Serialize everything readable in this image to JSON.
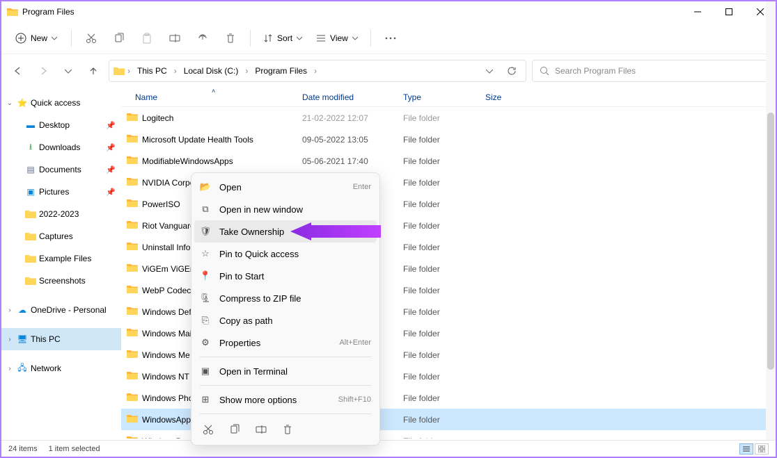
{
  "window": {
    "title": "Program Files"
  },
  "toolbar": {
    "new_label": "New",
    "sort_label": "Sort",
    "view_label": "View"
  },
  "breadcrumb": [
    "This PC",
    "Local Disk (C:)",
    "Program Files"
  ],
  "search": {
    "placeholder": "Search Program Files"
  },
  "sidebar": {
    "quick_access": "Quick access",
    "desktop": "Desktop",
    "downloads": "Downloads",
    "documents": "Documents",
    "pictures": "Pictures",
    "f_2022": "2022-2023",
    "captures": "Captures",
    "example": "Example Files",
    "screenshots": "Screenshots",
    "onedrive": "OneDrive - Personal",
    "thispc": "This PC",
    "network": "Network"
  },
  "columns": {
    "name": "Name",
    "date": "Date modified",
    "type": "Type",
    "size": "Size"
  },
  "files": [
    {
      "name": "Logitech",
      "date": "21-02-2022 12:07",
      "type": "File folder",
      "dimmed": true
    },
    {
      "name": "Microsoft Update Health Tools",
      "date": "09-05-2022 13:05",
      "type": "File folder"
    },
    {
      "name": "ModifiableWindowsApps",
      "date": "05-06-2021 17:40",
      "type": "File folder"
    },
    {
      "name": "NVIDIA Corpo",
      "date": "",
      "type": "File folder"
    },
    {
      "name": "PowerISO",
      "date": "",
      "type": "File folder"
    },
    {
      "name": "Riot Vanguard",
      "date": "",
      "type": "File folder"
    },
    {
      "name": "Uninstall Infor",
      "date": "",
      "type": "File folder"
    },
    {
      "name": "ViGEm ViGEm",
      "date": "",
      "type": "File folder"
    },
    {
      "name": "WebP Codec",
      "date": "",
      "type": "File folder"
    },
    {
      "name": "Windows Def",
      "date": "",
      "type": "File folder"
    },
    {
      "name": "Windows Mai",
      "date": "",
      "type": "File folder"
    },
    {
      "name": "Windows Me",
      "date": "",
      "type": "File folder"
    },
    {
      "name": "Windows NT",
      "date": "",
      "type": "File folder"
    },
    {
      "name": "Windows Pho",
      "date": "",
      "type": "File folder"
    },
    {
      "name": "WindowsApp",
      "date": "",
      "type": "File folder",
      "selected": true
    },
    {
      "name": "WindowsPow",
      "date": "",
      "type": "File folder"
    }
  ],
  "context_menu": {
    "open": "Open",
    "open_sc": "Enter",
    "open_new": "Open in new window",
    "take_ownership": "Take Ownership",
    "pin_quick": "Pin to Quick access",
    "pin_start": "Pin to Start",
    "compress": "Compress to ZIP file",
    "copy_path": "Copy as path",
    "properties": "Properties",
    "properties_sc": "Alt+Enter",
    "terminal": "Open in Terminal",
    "more": "Show more options",
    "more_sc": "Shift+F10"
  },
  "status": {
    "count": "24 items",
    "selected": "1 item selected"
  }
}
